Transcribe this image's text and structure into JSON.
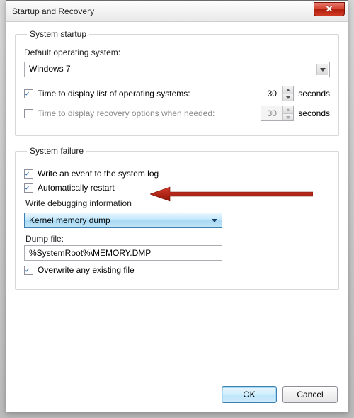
{
  "window": {
    "title": "Startup and Recovery",
    "close_glyph": "✕"
  },
  "startup": {
    "legend": "System startup",
    "default_os_label": "Default operating system:",
    "default_os_value": "Windows 7",
    "time_list_label": "Time to display list of operating systems:",
    "time_list_value": "30",
    "time_list_checked": true,
    "time_recovery_label": "Time to display recovery options when needed:",
    "time_recovery_value": "30",
    "time_recovery_checked": false,
    "seconds": "seconds"
  },
  "failure": {
    "legend": "System failure",
    "write_event_label": "Write an event to the system log",
    "write_event_checked": true,
    "auto_restart_label": "Automatically restart",
    "auto_restart_checked": true,
    "write_debug_label": "Write debugging information",
    "dump_type_value": "Kernel memory dump",
    "dump_file_label": "Dump file:",
    "dump_file_value": "%SystemRoot%\\MEMORY.DMP",
    "overwrite_label": "Overwrite any existing file",
    "overwrite_checked": true
  },
  "buttons": {
    "ok": "OK",
    "cancel": "Cancel"
  }
}
